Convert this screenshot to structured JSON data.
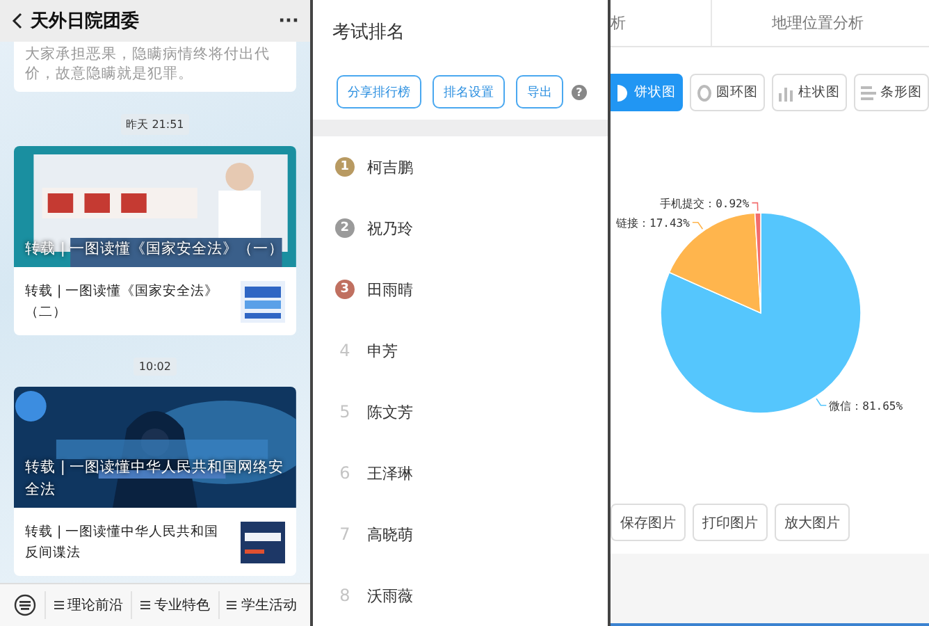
{
  "chat": {
    "title": "天外日院团委",
    "more": "···",
    "note": "大家承担恶果，隐瞒病情终将付出代价，故意隐瞒就是犯罪。",
    "groups": [
      {
        "time": "昨天 21:51",
        "headline": "转载 | 一图读懂《国家安全法》（一）",
        "sub": "转载 | 一图读懂《国家安全法》（二）",
        "kind": "picture"
      },
      {
        "time": "10:02",
        "headline": "转载 | 一图读懂中华人民共和国网络安全法",
        "sub": "转载 | 一图读懂中华人民共和国反间谍法",
        "kind": "picture"
      }
    ],
    "menu": [
      "理论前沿",
      "专业特色",
      "学生活动"
    ]
  },
  "ranking": {
    "title": "考试排名",
    "buttons": [
      "分享排行榜",
      "排名设置",
      "导出"
    ],
    "help": "?",
    "rows": [
      {
        "rank": "1",
        "name": "柯吉鹏",
        "kind": "medal",
        "color": "#b89a62"
      },
      {
        "rank": "2",
        "name": "祝乃玲",
        "kind": "medal",
        "color": "#9a9a9a"
      },
      {
        "rank": "3",
        "name": "田雨晴",
        "kind": "medal",
        "color": "#c07060"
      },
      {
        "rank": "4",
        "name": "申芳",
        "kind": "plain"
      },
      {
        "rank": "5",
        "name": "陈文芳",
        "kind": "plain"
      },
      {
        "rank": "6",
        "name": "王泽琳",
        "kind": "plain"
      },
      {
        "rank": "7",
        "name": "高晓萌",
        "kind": "plain"
      },
      {
        "rank": "8",
        "name": "沃雨薇",
        "kind": "plain"
      }
    ]
  },
  "analysis": {
    "tabs": [
      {
        "label": "析",
        "selected": false
      },
      {
        "label": "地理位置分析",
        "selected": false
      }
    ],
    "chart_types": [
      {
        "label": "饼状图",
        "kind": "pie",
        "selected": true
      },
      {
        "label": "圆环图",
        "kind": "donut",
        "selected": false
      },
      {
        "label": "柱状图",
        "kind": "bar",
        "selected": false
      },
      {
        "label": "条形图",
        "kind": "hbar",
        "selected": false
      }
    ],
    "chart_data": {
      "type": "pie",
      "values": [
        81.65,
        17.43,
        0.92
      ],
      "colors": [
        "#55c6fd",
        "#ffb54d",
        "#f26d6d"
      ],
      "value_labels": [
        "微信：81.65%",
        "链接：17.43%",
        "手机提交：0.92%"
      ]
    },
    "actions": [
      "保存图片",
      "打印图片",
      "放大图片"
    ]
  }
}
